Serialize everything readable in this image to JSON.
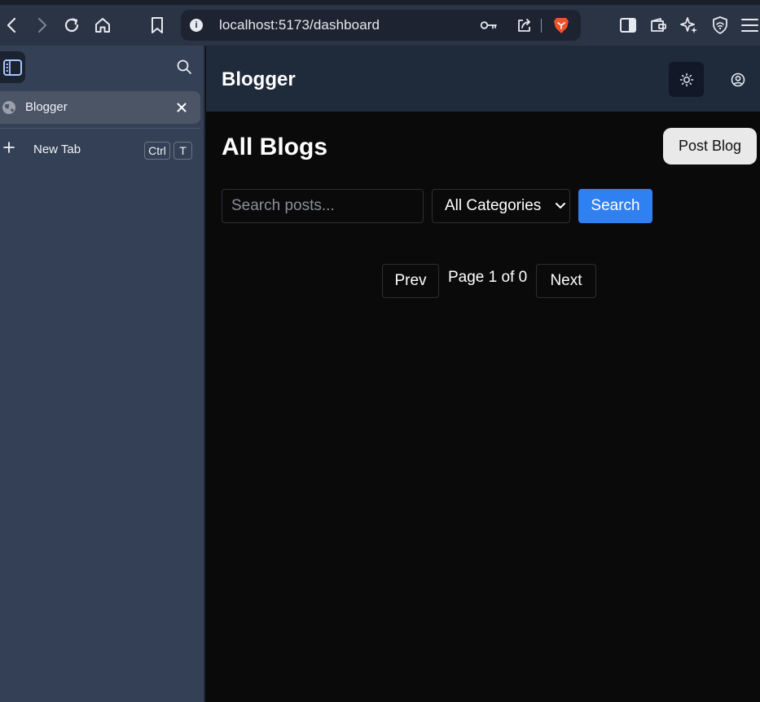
{
  "browser": {
    "url": "localhost:5173/dashboard",
    "tab": {
      "title": "Blogger"
    },
    "new_tab": {
      "label": "New Tab",
      "shortcut_keys": [
        "Ctrl",
        "T"
      ]
    },
    "icons": [
      "back-icon",
      "forward-icon",
      "reload-icon",
      "home-icon",
      "bookmark-icon",
      "site-info-icon",
      "key-icon",
      "share-icon",
      "brave-shields-icon",
      "sidebar-toggle-icon",
      "wallet-icon",
      "leo-ai-icon",
      "vpn-icon",
      "menu-icon"
    ]
  },
  "app": {
    "brand": "Blogger",
    "page_title": "All Blogs",
    "post_button": "Post Blog",
    "search": {
      "placeholder": "Search posts...",
      "value": ""
    },
    "category_select": {
      "selected": "All Categories"
    },
    "search_button": "Search",
    "pagination": {
      "prev": "Prev",
      "label": "Page 1 of 0",
      "next": "Next"
    }
  },
  "colors": {
    "accent": "#2f80f0",
    "header_bg": "#1f2a3b",
    "page_bg": "#0a0a0a",
    "sidebar_bg": "#334055",
    "brave_orange": "#f0522a"
  }
}
